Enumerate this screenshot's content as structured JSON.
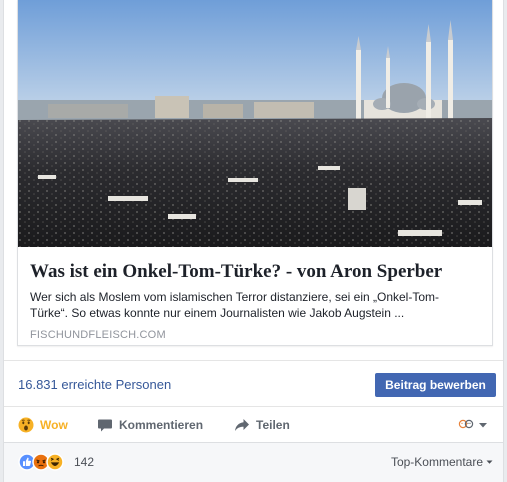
{
  "link_preview": {
    "title": "Was ist ein Onkel-Tom-Türke? - von Aron Sperber",
    "description": "Wer sich als Moslem vom islamischen Terror distanziere, sei ein „Onkel-Tom-Türke“. So etwas konnte nur einem Journalisten wie Jakob Augstein ...",
    "domain": "FISCHUNDFLEISCH.COM",
    "image_icon": "mosque-crowd-photo"
  },
  "reach": {
    "text": "16.831 erreichte Personen",
    "boost_label": "Beitrag bewerben"
  },
  "actions": {
    "wow_label": "Wow",
    "comment_label": "Kommentieren",
    "share_label": "Teilen"
  },
  "summary": {
    "reaction_count": "142",
    "top_comments_label": "Top-Kommentare"
  },
  "colors": {
    "link_blue": "#365899",
    "button_blue": "#4267b2",
    "wow_yellow": "#f7b125",
    "muted_gray": "#606770"
  }
}
